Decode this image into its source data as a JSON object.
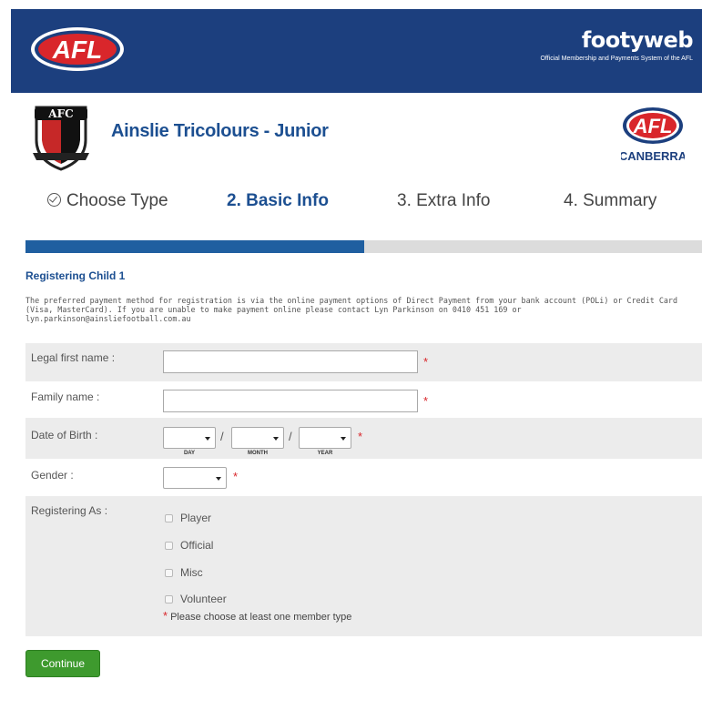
{
  "header": {
    "afl_logo_icon": "afl-logo",
    "afl_logo_text": "AFL",
    "brand_name": "footyweb",
    "brand_tagline": "Official Membership and Payments System of the AFL",
    "bg_color": "#1c3f7e"
  },
  "club": {
    "name": "Ainslie Tricolours - Junior",
    "club_logo_text": "AFC",
    "canberra_logo_text": "AFL",
    "canberra_logo_subtext": "CANBERRA"
  },
  "steps": [
    {
      "label": "Choose Type",
      "state": "complete",
      "icon": "check-circle-icon"
    },
    {
      "label": "2. Basic Info",
      "state": "active"
    },
    {
      "label": "3. Extra Info",
      "state": "pending"
    },
    {
      "label": "4. Summary",
      "state": "pending"
    }
  ],
  "progress": {
    "fraction": 0.5,
    "fill_color": "#1f5fa0"
  },
  "section": {
    "title": "Registering Child 1",
    "info_lines": [
      "The preferred payment method for registration is via the online payment options of Direct Payment from your bank account (POLi) or Credit Card",
      "(Visa, MasterCard). If you are unable to make payment online please contact Lyn Parkinson on 0410 451 169 or",
      "lyn.parkinson@ainsliefootball.com.au"
    ]
  },
  "form": {
    "first_name": {
      "label": "Legal first name :",
      "value": "",
      "required_mark": "*"
    },
    "family_name": {
      "label": "Family name :",
      "value": "",
      "required_mark": "*"
    },
    "dob": {
      "label": "Date of Birth :",
      "separator": "/",
      "day_label": "DAY",
      "month_label": "MONTH",
      "year_label": "YEAR",
      "required_mark": "*"
    },
    "gender": {
      "label": "Gender :",
      "value": "",
      "required_mark": "*"
    },
    "registering_as": {
      "label": "Registering As :",
      "options": [
        "Player",
        "Official",
        "Misc",
        "Volunteer"
      ],
      "note_star": "*",
      "note": "Please choose at least one member type"
    }
  },
  "actions": {
    "continue_label": "Continue",
    "continue_color": "#3e9a2e"
  }
}
